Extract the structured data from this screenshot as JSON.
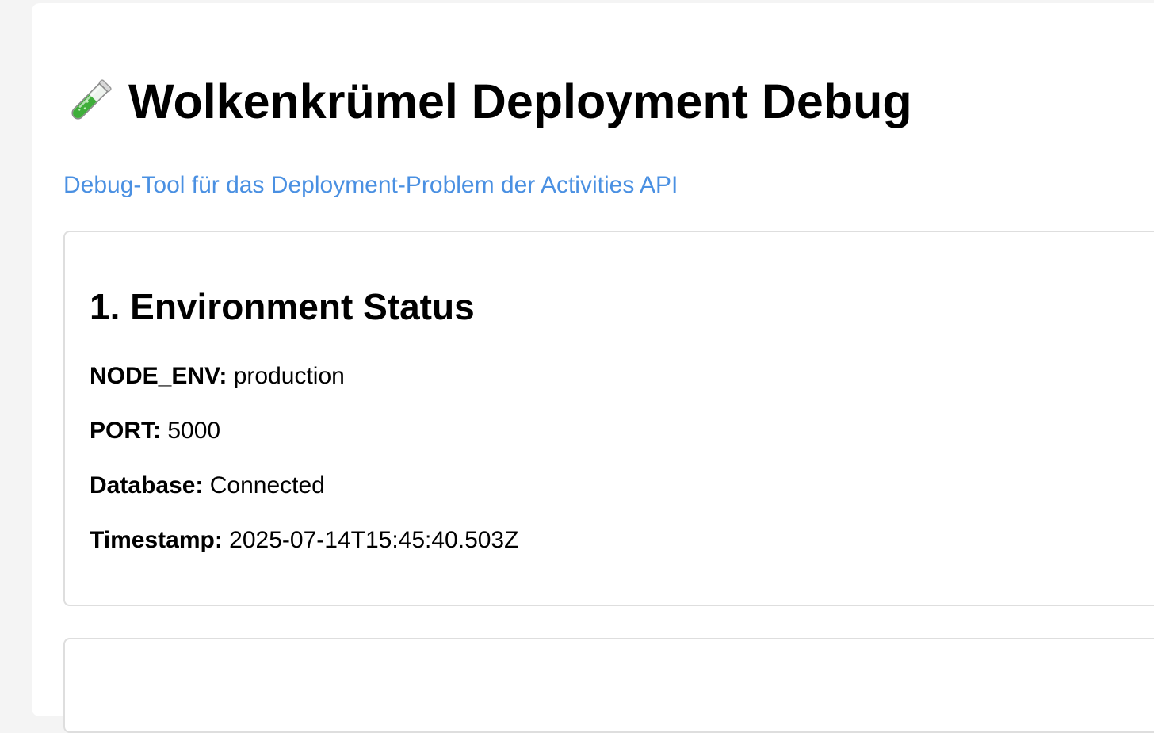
{
  "header": {
    "title": "Wolkenkrümel Deployment Debug",
    "icon": "test-tube-icon",
    "subtitle": "Debug-Tool für das Deployment-Problem der Activities API"
  },
  "environment": {
    "title": "1. Environment Status",
    "fields": [
      {
        "key": "NODE_ENV:",
        "value": "production"
      },
      {
        "key": "PORT:",
        "value": "5000"
      },
      {
        "key": "Database:",
        "value": "Connected"
      },
      {
        "key": "Timestamp:",
        "value": "2025-07-14T15:45:40.503Z"
      }
    ]
  },
  "colors": {
    "accent": "#4a90e2",
    "background": "#f4f4f4",
    "card_border": "#dedede"
  }
}
